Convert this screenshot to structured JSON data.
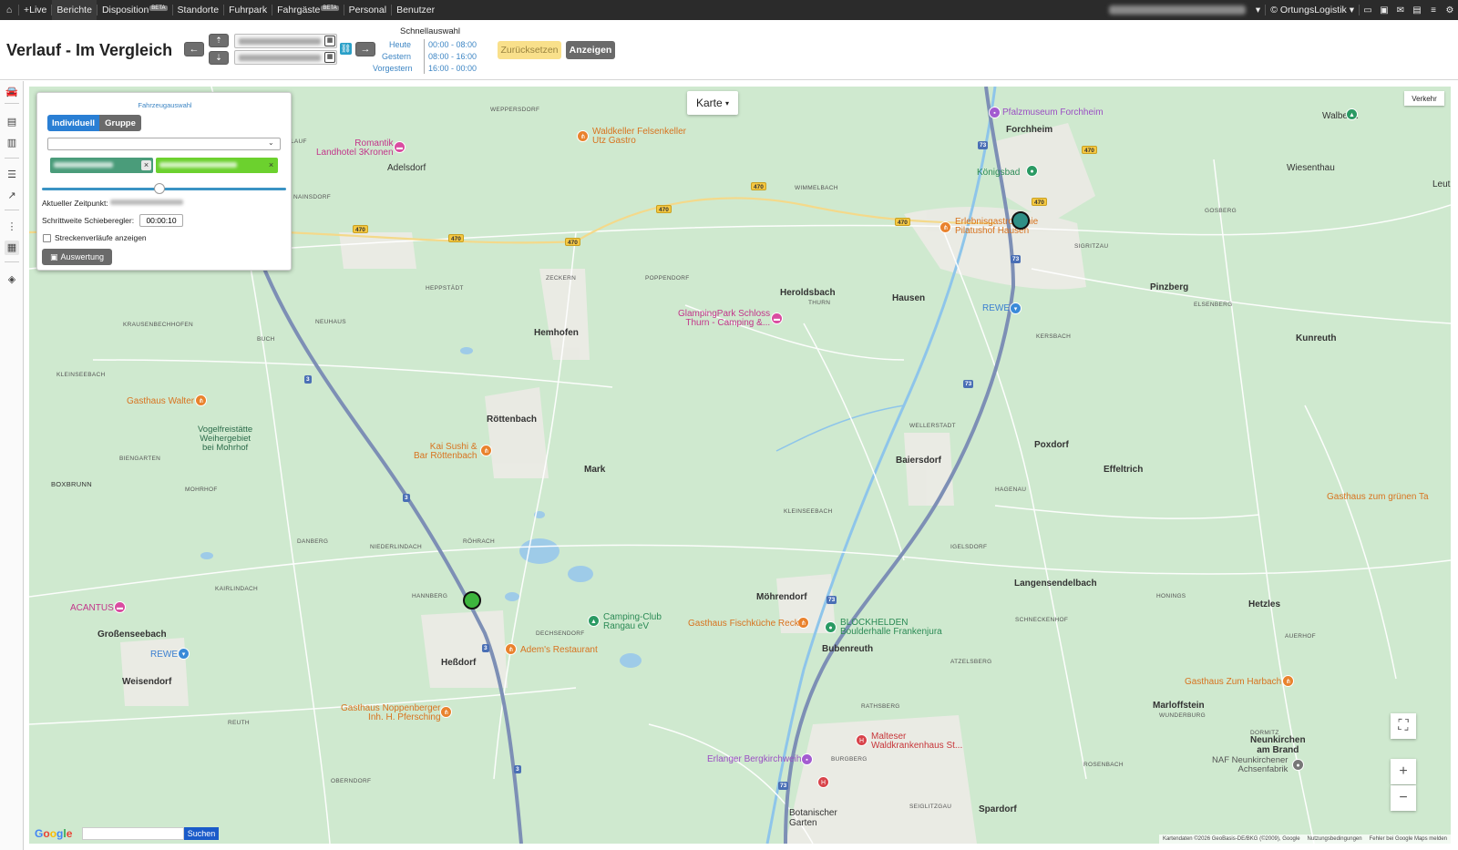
{
  "topnav": {
    "items": [
      {
        "label": "+Live"
      },
      {
        "label": "Berichte",
        "active": true
      },
      {
        "label": "Disposition",
        "beta": "BETA"
      },
      {
        "label": "Standorte"
      },
      {
        "label": "Fuhrpark"
      },
      {
        "label": "Fahrgäste",
        "beta": "BETA"
      },
      {
        "label": "Personal"
      },
      {
        "label": "Benutzer"
      }
    ],
    "company": "© OrtungsLogistik"
  },
  "header": {
    "title": "Verlauf - Im Vergleich",
    "quick_title": "Schnellauswahl",
    "quick": [
      {
        "label": "Heute",
        "time": "00:00 - 08:00"
      },
      {
        "label": "Gestern",
        "time": "08:00 - 16:00"
      },
      {
        "label": "Vorgestern",
        "time": "16:00 - 00:00"
      }
    ],
    "reset_label": "Zurücksetzen",
    "show_label": "Anzeigen",
    "prev_arrow": "←",
    "next_arrow": "→"
  },
  "panel": {
    "title": "Fahrzeugauswahl",
    "tab_individual": "Individuell",
    "tab_group": "Gruppe",
    "current_time_label": "Aktueller Zeitpunkt:",
    "step_label": "Schrittweite Schieberegler:",
    "step_value": "00:00:10",
    "routes_label": "Streckenverläufe anzeigen",
    "evaluate_label": "Auswertung",
    "slider_fraction": 0.48
  },
  "map": {
    "type_label": "Karte",
    "traffic_label": "Verkehr",
    "search_button": "Suchen",
    "attribution": [
      "Kartendaten ©2026 GeoBasis-DE/BKG (©2009), Google",
      "Nutzungsbedingungen",
      "Fehler bei Google Maps melden"
    ],
    "places": {
      "forchheim": "Forchheim",
      "wiesenthau": "Wiesenthau",
      "adelsdorf": "Adelsdorf",
      "heroldsbach": "Heroldsbach",
      "hausen": "Hausen",
      "pinzberg": "Pinzberg",
      "kunreuth": "Kunreuth",
      "hemhofen": "Hemhofen",
      "roettenbach": "Röttenbach",
      "mark": "Mark",
      "baiersdorf": "Baiersdorf",
      "poxdorf": "Poxdorf",
      "effeltrich": "Effeltrich",
      "langensendelbach": "Langensendelbach",
      "moehrendorf": "Möhrendorf",
      "hetzles": "Hetzles",
      "grossenseebach": "Großenseebach",
      "hessdorf": "Heßdorf",
      "weisendorf": "Weisendorf",
      "bubenreuth": "Bubenreuth",
      "marloffstein": "Marloffstein",
      "neunkirchen": "Neunkirchen\nam Brand",
      "spardorf": "Spardorf",
      "botanischer": "Botanischer\nGarten",
      "boxbrunn": "BOXBRUNN",
      "walberla": "Walberla",
      "leut": "Leut"
    },
    "pois": {
      "pfalzmuseum": "Pfalzmuseum Forchheim",
      "koenigsbad": "Königsbad",
      "erlebnis": "Erlebnisgastronomie\nPilatushof Hausen",
      "rewe1": "REWE",
      "rewe2": "REWE",
      "waldkeller": "Waldkeller Felsenkeller\nUtz Gastro",
      "romantik": "Romantik\nLandhotel 3Kronen",
      "glamping": "GlampingPark Schloss\nThurn - Camping &...",
      "walter": "Gasthaus Walter",
      "vogelfrei": "Vogelfreistätte\nWeihergebiet\nbei Mohrhof",
      "kaisushi": "Kai Sushi &\nBar Röttenbach",
      "acantus": "ACANTUS",
      "camping": "Camping-Club\nRangau eV",
      "adems": "Adem's Restaurant",
      "fischkueche": "Gasthaus Fischküche Reck",
      "blockhelden": "BLOCKHELDEN\nBoulderhalle Frankenjura",
      "noppenberger": "Gasthaus Noppenberger\nInh. H. Pfersching",
      "malteser": "Malteser\nWaldkrankenhaus St...",
      "bergkirchweih": "Erlanger Bergkirchweih",
      "naf": "NAF Neunkirchener\nAchsenfabrik",
      "zumharbach": "Gasthaus Zum Harbach",
      "gruenenta": "Gasthaus zum grünen Ta"
    },
    "villages": {
      "weppersdorf": "WEPPERSDORF",
      "lauf": "LAUF",
      "nainsdorf": "NAINSDORF",
      "wimmelbach": "WIMMELBACH",
      "zeckern": "ZECKERN",
      "poppendorf": "POPPENDORF",
      "heppstaedt": "HEPPSTÄDT",
      "neuhaus": "NEUHAUS",
      "thurn": "THURN",
      "krausenbechhofen": "KRAUSENBECHHOFEN",
      "buch": "BUCH",
      "kleinseebach": "KLEINSEEBACH",
      "biengarten": "BIENGARTEN",
      "mohrhof": "MOHRHOF",
      "danberg": "DANBERG",
      "niederlindach": "NIEDERLINDACH",
      "roehrach": "RÖHRACH",
      "kairlindach": "KAIRLINDACH",
      "hannberg": "HANNBERG",
      "dechsendorf": "DECHSENDORF",
      "hagenau": "HAGENAU",
      "wellerstadt": "WELLERSTADT",
      "kleinseebach2": "KLEINSEEBACH",
      "igelsdorf": "IGELSDORF",
      "schneckenhof": "SCHNECKENHOF",
      "honings": "HONINGS",
      "atzelsberg": "ATZELSBERG",
      "rathsberg": "RATHSBERG",
      "wunderburg": "WUNDERBURG",
      "rosenbach": "ROSENBACH",
      "gosberg": "GOSBERG",
      "sigritzau": "SIGRITZAU",
      "kersbach": "KERSBACH",
      "elsenberg": "ELSENBERG",
      "burgberg": "BURGBERG",
      "seidlitzgau": "SEIGLITZGAU",
      "oberndorf": "OBERNDORF",
      "reuth": "REUTH",
      "dormitz": "DORMITZ",
      "aurachhof": "AUERHOF"
    }
  }
}
